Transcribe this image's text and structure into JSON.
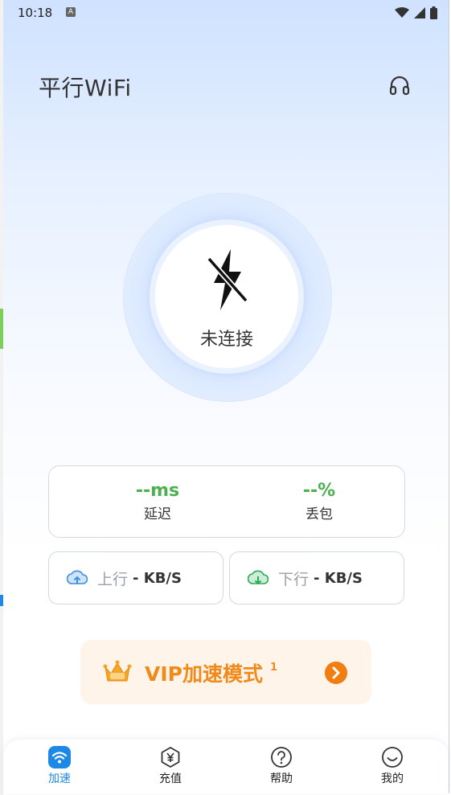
{
  "status_bar": {
    "time": "10:18",
    "notification_badge": "A"
  },
  "header": {
    "title": "平行WiFi",
    "support_icon": "headset-icon"
  },
  "connect": {
    "status": "未连接",
    "icon": "bolt-off-icon"
  },
  "stats": {
    "latency": {
      "value": "--ms",
      "label": "延迟"
    },
    "packet_loss": {
      "value": "--%",
      "label": "丢包"
    }
  },
  "speed": {
    "upload": {
      "direction": "上行",
      "value": "- KB/S"
    },
    "download": {
      "direction": "下行",
      "value": "- KB/S"
    }
  },
  "vip": {
    "label": "VIP加速模式",
    "superscript": "1"
  },
  "nav": {
    "items": [
      {
        "label": "加速",
        "icon": "wifi-icon",
        "active": true
      },
      {
        "label": "充值",
        "icon": "yen-icon",
        "active": false
      },
      {
        "label": "帮助",
        "icon": "help-icon",
        "active": false
      },
      {
        "label": "我的",
        "icon": "smile-icon",
        "active": false
      }
    ]
  },
  "colors": {
    "accent_blue": "#1e88e5",
    "stat_green": "#4caf50",
    "vip_orange": "#f08a1a",
    "vip_background": "#fff4ea"
  }
}
